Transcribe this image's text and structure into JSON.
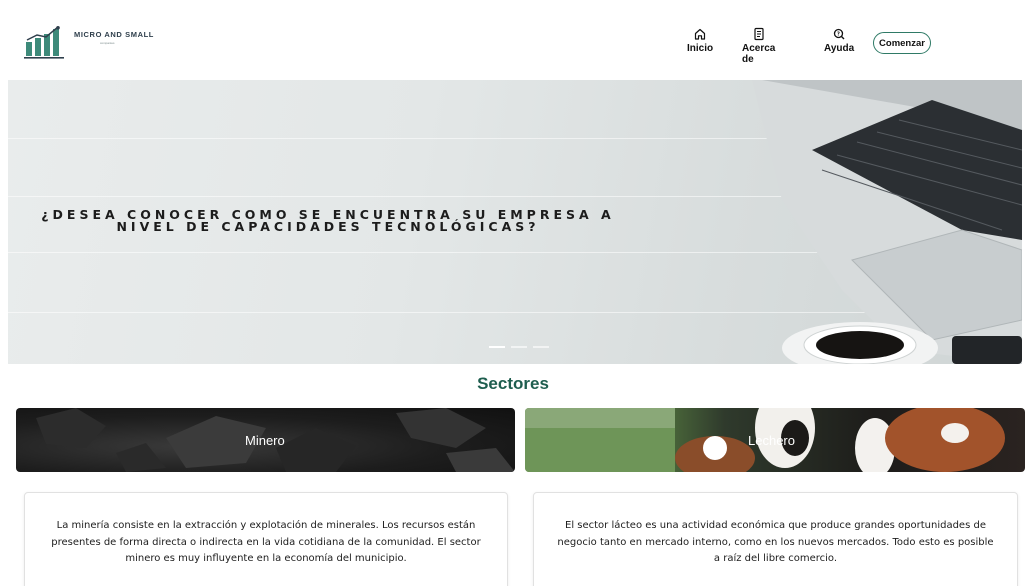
{
  "brand": {
    "name": "MICRO AND SMALL",
    "tagline": "companies"
  },
  "nav": {
    "items": [
      {
        "label": "Inicio",
        "icon": "home-icon"
      },
      {
        "label": "Acerca de",
        "icon": "document-icon"
      },
      {
        "label": "Ayuda",
        "icon": "help-search-icon"
      }
    ],
    "cta_label": "Comenzar"
  },
  "hero": {
    "line1": "¿DESEA CONOCER COMO SE ENCUENTRA SU EMPRESA A",
    "line2": "NIVEL DE CAPACIDADES TECNOLÓGICAS?",
    "slides_total": 3,
    "active_slide": 1
  },
  "sectors": {
    "title": "Sectores",
    "cards": [
      {
        "label": "Minero",
        "description": "La minería consiste en la extracción y explotación de minerales. Los recursos están presentes de forma directa o indirecta en la vida cotidiana de la comunidad. El sector minero es muy influyente en la economía del municipio."
      },
      {
        "label": "Lechero",
        "description": "El sector lácteo es una actividad económica que produce grandes oportunidades de negocio tanto en mercado interno, como en los nuevos mercados. Todo esto es posible a raíz del libre comercio."
      }
    ]
  },
  "colors": {
    "accent": "#1f5e4f",
    "cta_border": "#2f7a66"
  }
}
